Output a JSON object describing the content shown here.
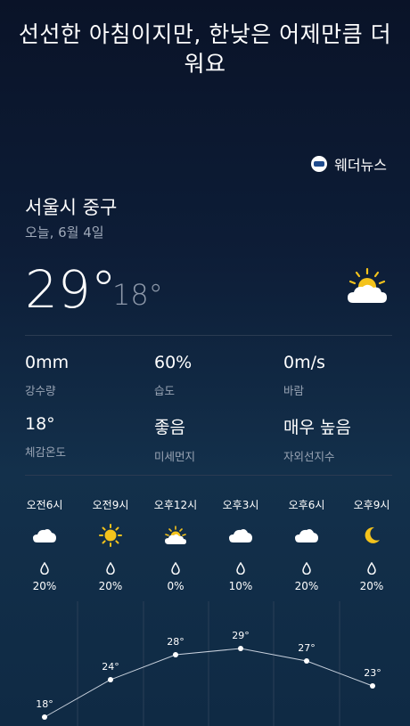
{
  "headline": "선선한 아침이지만, 한낮은 어제만큼 더워요",
  "source": {
    "name": "웨더뉴스",
    "icon": "weathernews-logo-icon"
  },
  "location": "서울시 중구",
  "date": "오늘, 6월 4일",
  "current": {
    "temp": "29°",
    "low": "18°",
    "icon": "partly-cloudy-sun-icon"
  },
  "stats": [
    {
      "value": "0mm",
      "label": "강수량"
    },
    {
      "value": "60%",
      "label": "습도"
    },
    {
      "value": "0m/s",
      "label": "바람"
    },
    {
      "value": "18°",
      "label": "체감온도"
    },
    {
      "value": "좋음",
      "label": "미세먼지"
    },
    {
      "value": "매우 높음",
      "label": "자외선지수"
    }
  ],
  "hourly": [
    {
      "time": "오전6시",
      "icon": "cloud-icon",
      "precip": "20%",
      "temp": 18,
      "temp_label": "18°"
    },
    {
      "time": "오전9시",
      "icon": "sun-icon",
      "precip": "20%",
      "temp": 24,
      "temp_label": "24°"
    },
    {
      "time": "오후12시",
      "icon": "partly-cloudy-sun-icon",
      "precip": "0%",
      "temp": 28,
      "temp_label": "28°"
    },
    {
      "time": "오후3시",
      "icon": "cloud-icon",
      "precip": "10%",
      "temp": 29,
      "temp_label": "29°"
    },
    {
      "time": "오후6시",
      "icon": "cloud-icon",
      "precip": "20%",
      "temp": 27,
      "temp_label": "27°"
    },
    {
      "time": "오후9시",
      "icon": "moon-icon",
      "precip": "20%",
      "temp": 23,
      "temp_label": "23°"
    }
  ],
  "colors": {
    "sun": "#f4c31c",
    "moon": "#f4c31c",
    "text_muted": "#9aa5b5",
    "graph_line": "#c7d0dc"
  }
}
